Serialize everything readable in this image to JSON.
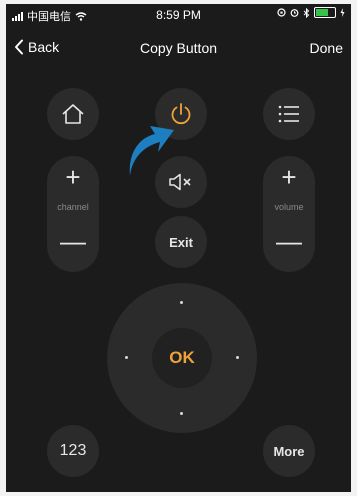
{
  "status_bar": {
    "carrier": "中国电信",
    "time": "8:59 PM"
  },
  "nav": {
    "back_label": "Back",
    "title": "Copy Button",
    "done_label": "Done"
  },
  "remote": {
    "channel_label": "channel",
    "volume_label": "volume",
    "exit_label": "Exit",
    "ok_label": "OK",
    "numbers_label": "123",
    "more_label": "More"
  },
  "colors": {
    "background": "#1b1b1b",
    "button": "#2b2b2b",
    "accent_orange": "#f0a23a",
    "arrow_blue": "#1e7fc0"
  },
  "icons": {
    "home": "home-icon",
    "power": "power-icon",
    "menu": "list-icon",
    "mute": "mute-icon",
    "hint": "arrow-pointer-icon"
  }
}
